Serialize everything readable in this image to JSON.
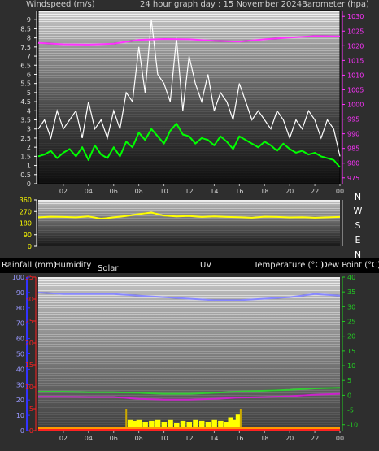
{
  "header": {
    "windspeed_label": "Windspeed (m/s)",
    "title": "24 hour graph day : 15 November 2024",
    "barometer_label": "Barometer (hpa)"
  },
  "direction_labels": [
    "N",
    "W",
    "S",
    "E",
    "N"
  ],
  "bottom_header": {
    "rainfall": "Rainfall (mm)",
    "humidity": "Humidity",
    "solar": "Solar",
    "uv": "UV",
    "temperature": "Temperature (°C)",
    "dewpoint": "Dew Point (°C)"
  },
  "colors": {
    "wind_gust": "#ffffff",
    "wind_avg": "#00ff00",
    "barometer": "#ff33ff",
    "direction": "#ffff00",
    "humidity": "#8888ff",
    "temperature": "#33cc33",
    "dewpoint": "#cc22cc",
    "solar": "#ffff00",
    "rain": "#ff2222",
    "wind_axis": "#ffffff",
    "baro_axis": "#ff33ff",
    "humidity_axis": "#3333ff",
    "rain_axis": "#ff2222",
    "temp_axis": "#22cc22"
  },
  "chart_data": [
    {
      "type": "line",
      "title": "24 hour graph day : 15 November 2024",
      "x_ticks": [
        "02",
        "04",
        "06",
        "08",
        "10",
        "12",
        "14",
        "16",
        "18",
        "20",
        "22",
        "00"
      ],
      "x_range_hours": [
        0,
        24
      ],
      "y_left": {
        "label": "Windspeed (m/s)",
        "range": [
          0,
          9.5
        ],
        "ticks": [
          "0",
          "0.5",
          "1",
          "1.5",
          "2",
          "2.5",
          "3",
          "3.5",
          "4",
          "4.5",
          "5",
          "5.5",
          "6",
          "6.5",
          "7",
          "7.5",
          "8",
          "8.5",
          "9"
        ]
      },
      "y_right": {
        "label": "Barometer (hpa)",
        "range": [
          973,
          1032
        ],
        "ticks": [
          "975",
          "980",
          "985",
          "990",
          "995",
          "1000",
          "1005",
          "1010",
          "1015",
          "1020",
          "1025",
          "1030"
        ]
      },
      "series": [
        {
          "name": "Windspeed (m/s)",
          "axis": "left",
          "x_hours": [
            0,
            0.5,
            1,
            1.5,
            2,
            2.5,
            3,
            3.5,
            4,
            4.5,
            5,
            5.5,
            6,
            6.5,
            7,
            7.5,
            8,
            8.5,
            9,
            9.5,
            10,
            10.5,
            11,
            11.5,
            12,
            12.5,
            13,
            13.5,
            14,
            14.5,
            15,
            15.5,
            16,
            16.5,
            17,
            17.5,
            18,
            18.5,
            19,
            19.5,
            20,
            20.5,
            21,
            21.5,
            22,
            22.5,
            23,
            23.5,
            24
          ],
          "values": [
            3.0,
            3.5,
            2.5,
            4.0,
            3.0,
            3.5,
            4.0,
            2.5,
            4.5,
            3.0,
            3.5,
            2.5,
            4.0,
            3.0,
            5.0,
            4.5,
            7.5,
            5.0,
            9.0,
            6.0,
            5.5,
            4.5,
            8.0,
            4.0,
            7.0,
            5.5,
            4.5,
            6.0,
            4.0,
            5.0,
            4.5,
            3.5,
            5.5,
            4.5,
            3.5,
            4.0,
            3.5,
            3.0,
            4.0,
            3.5,
            2.5,
            3.5,
            3.0,
            4.0,
            3.5,
            2.5,
            3.5,
            3.0,
            1.5
          ]
        },
        {
          "name": "Average windspeed (m/s)",
          "axis": "left",
          "x_hours": [
            0,
            0.5,
            1,
            1.5,
            2,
            2.5,
            3,
            3.5,
            4,
            4.5,
            5,
            5.5,
            6,
            6.5,
            7,
            7.5,
            8,
            8.5,
            9,
            9.5,
            10,
            10.5,
            11,
            11.5,
            12,
            12.5,
            13,
            13.5,
            14,
            14.5,
            15,
            15.5,
            16,
            16.5,
            17,
            17.5,
            18,
            18.5,
            19,
            19.5,
            20,
            20.5,
            21,
            21.5,
            22,
            22.5,
            23,
            23.5,
            24
          ],
          "values": [
            1.5,
            1.6,
            1.8,
            1.4,
            1.7,
            1.9,
            1.5,
            2.0,
            1.3,
            2.1,
            1.6,
            1.4,
            2.0,
            1.5,
            2.3,
            2.0,
            2.8,
            2.4,
            3.0,
            2.6,
            2.2,
            2.9,
            3.3,
            2.7,
            2.6,
            2.2,
            2.5,
            2.4,
            2.1,
            2.6,
            2.3,
            1.9,
            2.6,
            2.4,
            2.2,
            2.0,
            2.3,
            2.1,
            1.8,
            2.2,
            1.9,
            1.7,
            1.8,
            1.6,
            1.7,
            1.5,
            1.4,
            1.3,
            0.9
          ]
        },
        {
          "name": "Barometer (hpa)",
          "axis": "right",
          "x_hours": [
            0,
            2,
            4,
            6,
            8,
            10,
            12,
            14,
            16,
            18,
            20,
            22,
            24
          ],
          "values": [
            1021.0,
            1020.5,
            1020.4,
            1020.7,
            1022.0,
            1022.3,
            1022.2,
            1021.7,
            1021.4,
            1022.2,
            1022.8,
            1023.3,
            1023.2
          ]
        }
      ]
    },
    {
      "type": "line",
      "title": "",
      "x_ticks": [
        "02",
        "04",
        "06",
        "08",
        "10",
        "12",
        "14",
        "16",
        "18",
        "20",
        "22",
        "00"
      ],
      "x_range_hours": [
        0,
        24
      ],
      "y_left": {
        "label": "",
        "range": [
          0,
          360
        ],
        "ticks": [
          "0",
          "90",
          "180",
          "270",
          "360"
        ]
      },
      "series": [
        {
          "name": "Wind direction",
          "axis": "left",
          "x_hours": [
            0,
            1,
            2,
            3,
            4,
            5,
            6,
            7,
            8,
            9,
            10,
            11,
            12,
            13,
            14,
            15,
            16,
            17,
            18,
            19,
            20,
            21,
            22,
            23,
            24
          ],
          "values": [
            225,
            230,
            228,
            225,
            232,
            215,
            225,
            235,
            250,
            262,
            238,
            232,
            235,
            228,
            232,
            228,
            226,
            222,
            230,
            228,
            224,
            226,
            222,
            225,
            228
          ]
        }
      ]
    },
    {
      "type": "line",
      "title": "",
      "x_ticks": [
        "02",
        "04",
        "06",
        "08",
        "10",
        "12",
        "14",
        "16",
        "18",
        "20",
        "22",
        "00"
      ],
      "x_range_hours": [
        0,
        24
      ],
      "y_left": {
        "label": "Humidity",
        "range": [
          0,
          100
        ],
        "ticks": [
          "0",
          "10",
          "20",
          "30",
          "40",
          "50",
          "60",
          "70",
          "80",
          "90",
          "100"
        ]
      },
      "y_left_inner": {
        "label": "Rainfall (mm)",
        "range": [
          0,
          35
        ],
        "ticks": [
          "0",
          "5",
          "10",
          "15",
          "20",
          "25",
          "30",
          "35"
        ]
      },
      "y_right": {
        "label": "Temperature (°C)",
        "range": [
          -12,
          40
        ],
        "ticks": [
          "-10",
          "-5",
          "0",
          "5",
          "10",
          "15",
          "20",
          "25",
          "30",
          "35",
          "40"
        ]
      },
      "series": [
        {
          "name": "Humidity",
          "axis": "left",
          "x_hours": [
            0,
            2,
            4,
            6,
            8,
            10,
            12,
            14,
            16,
            18,
            20,
            22,
            24
          ],
          "values": [
            90,
            89,
            89,
            89,
            88,
            87,
            86,
            85,
            85,
            86,
            87,
            89,
            88
          ]
        },
        {
          "name": "Temperature (°C)",
          "axis": "right",
          "x_hours": [
            0,
            2,
            4,
            6,
            8,
            10,
            12,
            14,
            16,
            18,
            20,
            22,
            24
          ],
          "values": [
            1.2,
            1.2,
            1.0,
            1.0,
            0.8,
            0.5,
            0.5,
            0.8,
            1.3,
            1.5,
            1.8,
            2.3,
            2.5
          ]
        },
        {
          "name": "Dew Point (°C)",
          "axis": "right",
          "x_hours": [
            0,
            2,
            4,
            6,
            8,
            10,
            12,
            14,
            16,
            18,
            20,
            22,
            24
          ],
          "values": [
            -0.5,
            -0.5,
            -0.6,
            -0.6,
            -1.2,
            -1.5,
            -1.5,
            -1.2,
            -0.8,
            -0.6,
            -0.3,
            0.2,
            0.5
          ]
        },
        {
          "name": "Solar",
          "axis": "none",
          "x_hours": [
            7.3,
            7.6,
            8,
            8.5,
            9,
            9.5,
            10,
            10.5,
            11,
            11.5,
            12,
            12.5,
            13,
            13.5,
            14,
            14.5,
            15,
            15.3,
            15.6,
            15.9
          ],
          "values": [
            0.6,
            0.55,
            0.6,
            0.5,
            0.55,
            0.6,
            0.5,
            0.6,
            0.45,
            0.55,
            0.5,
            0.6,
            0.55,
            0.5,
            0.6,
            0.55,
            0.5,
            0.75,
            0.6,
            0.9
          ]
        },
        {
          "name": "Rainfall (mm)",
          "axis": "left_inner",
          "x_hours": [
            0,
            24
          ],
          "values": [
            0,
            0
          ]
        }
      ]
    }
  ]
}
